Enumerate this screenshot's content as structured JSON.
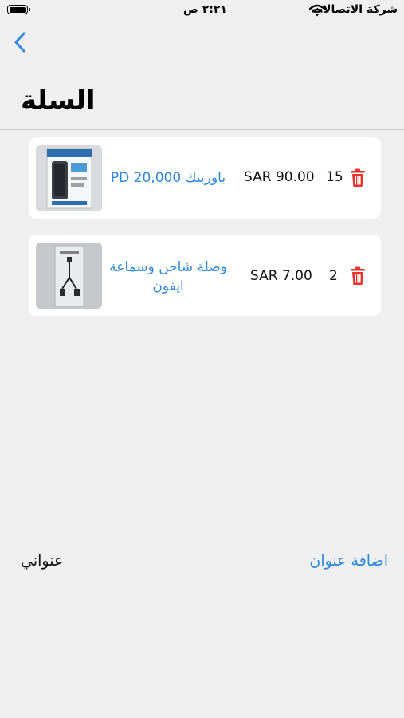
{
  "status_bar": {
    "time": "٢:٢١ ص",
    "carrier": "شركة الاتصالات"
  },
  "nav": {
    "title": "السلة"
  },
  "cart": {
    "items": [
      {
        "name": "باوربنك PD 20,000",
        "price": "SAR 90.00",
        "quantity": "15"
      },
      {
        "name": "وصلة شاحن وسماعة ايفون",
        "price": "SAR 7.00",
        "quantity": "2"
      }
    ]
  },
  "address": {
    "label": "عنواني",
    "add_label": "اضافة عنوان"
  },
  "colors": {
    "accent": "#2e89da",
    "delete": "#e8322b",
    "background": "#efeff0"
  }
}
